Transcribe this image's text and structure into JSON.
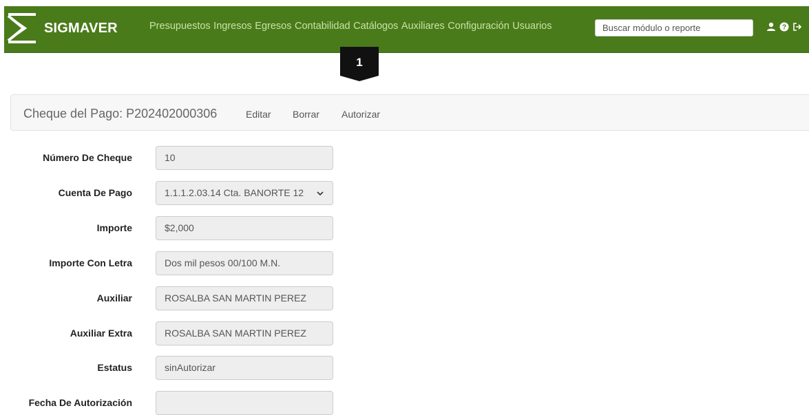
{
  "navbar": {
    "brand": "SIGMAVER",
    "links": [
      "Presupuestos",
      "Ingresos",
      "Egresos",
      "Contabilidad",
      "Catálogos",
      "Auxiliares",
      "Configuración",
      "Usuarios"
    ],
    "search_placeholder": "Buscar módulo o reporte",
    "icons": [
      "user-icon",
      "help-icon",
      "logout-icon"
    ],
    "colors": {
      "background": "#4a7b1b",
      "link": "#c8e3a6"
    }
  },
  "step_badge": {
    "number": "1"
  },
  "header_panel": {
    "title": "Cheque del Pago: P202402000306",
    "actions": [
      "Editar",
      "Borrar",
      "Autorizar"
    ]
  },
  "form": {
    "fields": [
      {
        "label": "Número De Cheque",
        "value": "10"
      },
      {
        "label": "Cuenta De Pago",
        "value": "1.1.1.2.03.14 Cta. BANORTE 12"
      },
      {
        "label": "Importe",
        "value": "$2,000"
      },
      {
        "label": "Importe Con Letra",
        "value": "Dos mil pesos 00/100 M.N."
      },
      {
        "label": "Auxiliar",
        "value": "ROSALBA SAN MARTIN PEREZ"
      },
      {
        "label": "Auxiliar Extra",
        "value": "ROSALBA SAN MARTIN PEREZ"
      },
      {
        "label": "Estatus",
        "value": "sinAutorizar"
      },
      {
        "label": "Fecha De Autorización",
        "value": ""
      }
    ]
  }
}
